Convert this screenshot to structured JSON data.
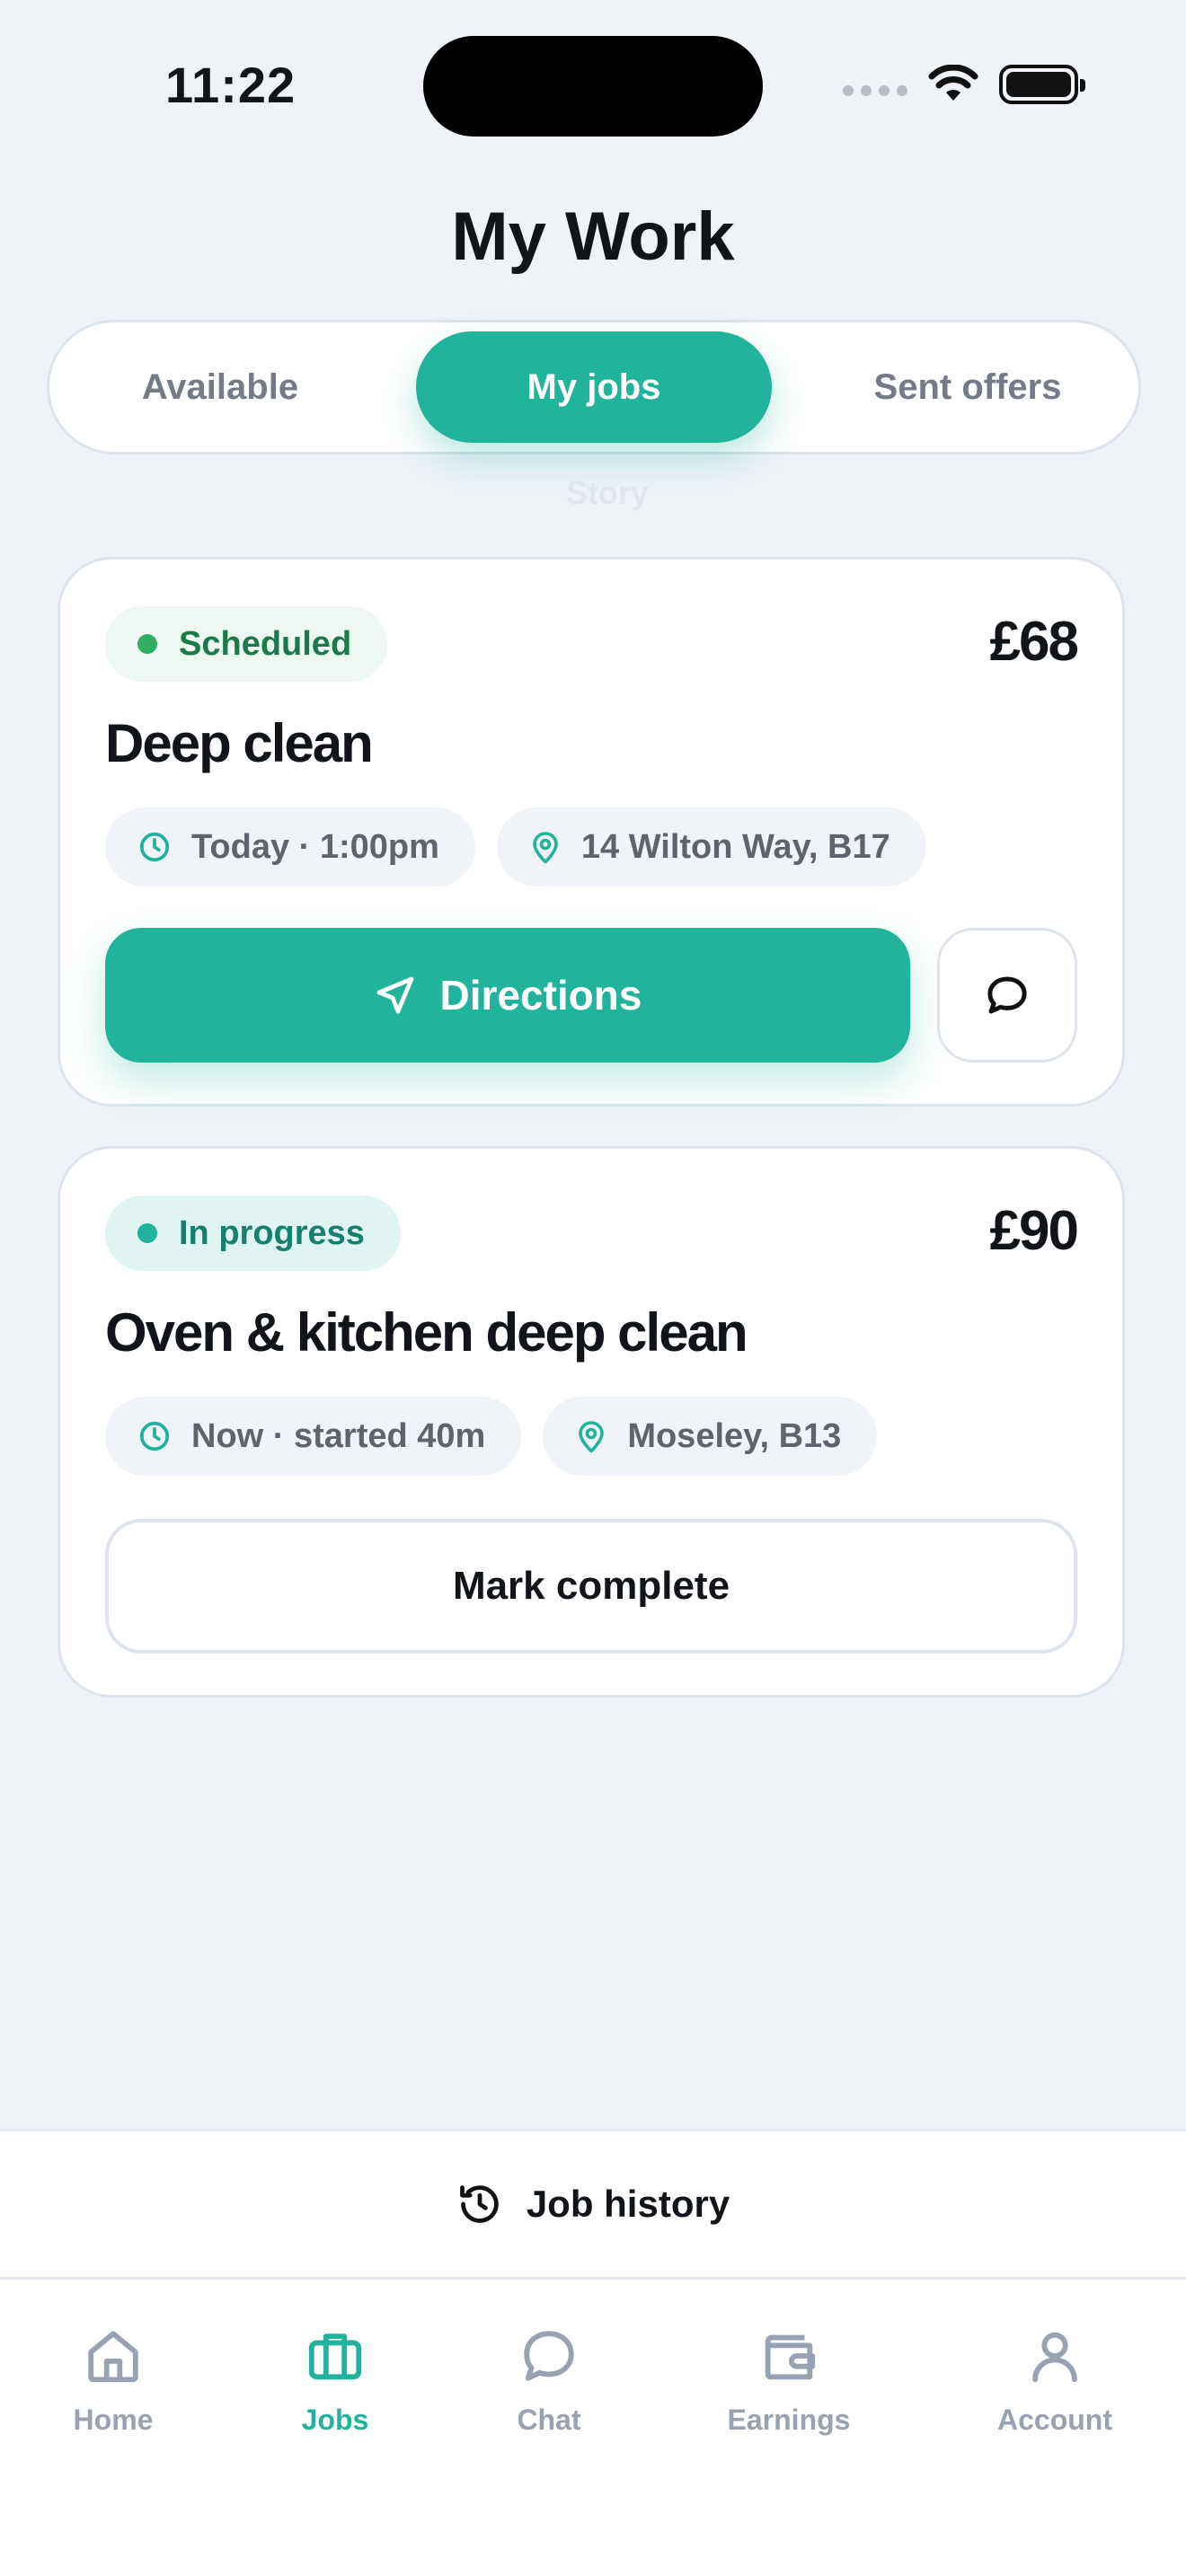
{
  "status_bar": {
    "time": "11:22"
  },
  "page": {
    "title": "My Work"
  },
  "tabs": [
    {
      "label": "Available",
      "active": false
    },
    {
      "label": "My jobs",
      "active": true
    },
    {
      "label": "Sent offers",
      "active": false
    }
  ],
  "ghost_text": "Story",
  "jobs": [
    {
      "status": "Scheduled",
      "price": "£68",
      "title": "Deep clean",
      "time": "Today · 1:00pm",
      "location": "14 Wilton Way, B17",
      "primary_action": "Directions"
    },
    {
      "status": "In progress",
      "price": "£90",
      "title": "Oven & kitchen deep clean",
      "time": "Now · started 40m",
      "location": "Moseley, B13",
      "primary_action": "Mark complete"
    }
  ],
  "history_link": "Job history",
  "nav": [
    {
      "label": "Home",
      "icon": "home-icon",
      "active": false
    },
    {
      "label": "Jobs",
      "icon": "briefcase-icon",
      "active": true
    },
    {
      "label": "Chat",
      "icon": "chat-icon",
      "active": false
    },
    {
      "label": "Earnings",
      "icon": "wallet-icon",
      "active": false
    },
    {
      "label": "Account",
      "icon": "user-icon",
      "active": false
    }
  ],
  "colors": {
    "accent": "#21b39c",
    "background": "#eff3f8",
    "scheduled_green": "#2fae63"
  }
}
